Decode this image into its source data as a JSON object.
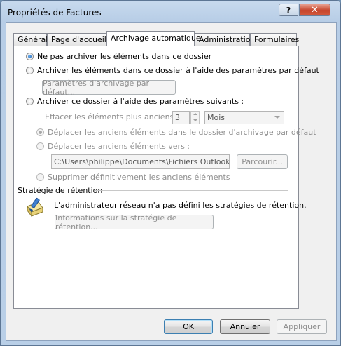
{
  "window": {
    "title": "Propriétés de Factures",
    "help_glyph": "?",
    "close_glyph": "✕"
  },
  "tabs": [
    {
      "label": "Général"
    },
    {
      "label": "Page d'accueil"
    },
    {
      "label": "Archivage automatique"
    },
    {
      "label": "Administration"
    },
    {
      "label": "Formulaires"
    }
  ],
  "active_tab": "Archivage automatique",
  "options": {
    "no_archive": "Ne pas archiver les éléments dans ce dossier",
    "default_archive": "Archiver les éléments dans ce dossier à l'aide des paramètres par défaut",
    "default_settings_button": "Paramètres d'archivage par défaut...",
    "custom_archive": "Archiver ce dossier à l'aide des paramètres suivants :",
    "clean_label": "Effacer les éléments plus anciens que",
    "clean_value": "3",
    "clean_unit": "Mois",
    "move_default": "Déplacer les anciens éléments dans le dossier d'archivage par défaut",
    "move_to": "Déplacer les anciens éléments vers :",
    "path": "C:\\Users\\philippe\\Documents\\Fichiers Outlook\\archiv",
    "browse_button": "Parcourir...",
    "delete_permanently": "Supprimer définitivement les anciens éléments"
  },
  "retention": {
    "heading": "Stratégie de rétention",
    "message": "L'administrateur réseau n'a pas défini les stratégies de rétention.",
    "info_button": "Informations sur la stratégie de rétention..."
  },
  "footer": {
    "ok": "OK",
    "cancel": "Annuler",
    "apply": "Appliquer"
  }
}
